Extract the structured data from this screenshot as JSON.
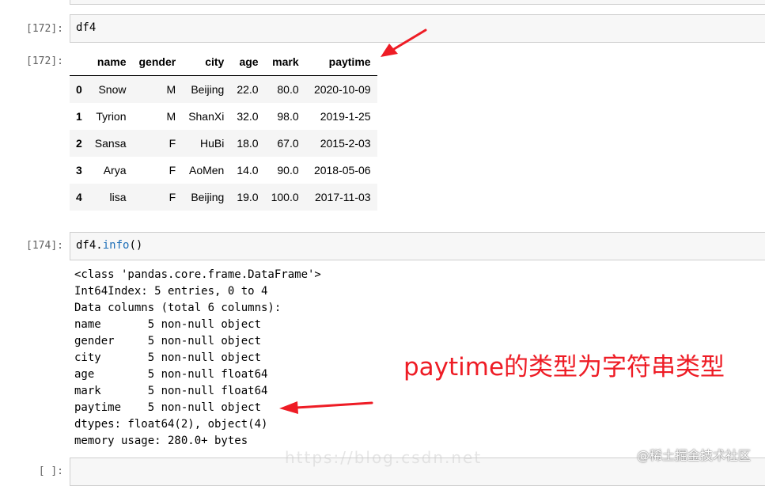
{
  "cells": [
    {
      "prompt": "[172]:",
      "code": "df4"
    },
    {
      "output_prompt": "[172]:"
    },
    {
      "prompt": "[174]:",
      "code_obj": "df4.",
      "code_fn": "info",
      "code_tail": "()"
    },
    {
      "prompt": "[ ]:"
    }
  ],
  "dataframe": {
    "columns": [
      "name",
      "gender",
      "city",
      "age",
      "mark",
      "paytime"
    ],
    "rows": [
      {
        "index": "0",
        "cells": [
          "Snow",
          "M",
          "Beijing",
          "22.0",
          "80.0",
          "2020-10-09"
        ]
      },
      {
        "index": "1",
        "cells": [
          "Tyrion",
          "M",
          "ShanXi",
          "32.0",
          "98.0",
          "2019-1-25"
        ]
      },
      {
        "index": "2",
        "cells": [
          "Sansa",
          "F",
          "HuBi",
          "18.0",
          "67.0",
          "2015-2-03"
        ]
      },
      {
        "index": "3",
        "cells": [
          "Arya",
          "F",
          "AoMen",
          "14.0",
          "90.0",
          "2018-05-06"
        ]
      },
      {
        "index": "4",
        "cells": [
          "lisa",
          "F",
          "Beijing",
          "19.0",
          "100.0",
          "2017-11-03"
        ]
      }
    ]
  },
  "info_output": [
    "<class 'pandas.core.frame.DataFrame'>",
    "Int64Index: 5 entries, 0 to 4",
    "Data columns (total 6 columns):",
    "name       5 non-null object",
    "gender     5 non-null object",
    "city       5 non-null object",
    "age        5 non-null float64",
    "mark       5 non-null float64",
    "paytime    5 non-null object",
    "dtypes: float64(2), object(4)",
    "memory usage: 280.0+ bytes"
  ],
  "annotation": "paytime的类型为字符串类型",
  "watermark": "@稀土掘金技术社区",
  "colors": {
    "annotation": "#ee1c25",
    "prompt": "#616161",
    "function": "#1e6fb8"
  }
}
